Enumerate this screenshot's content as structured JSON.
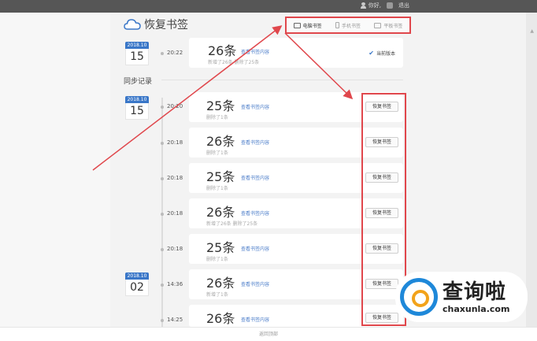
{
  "topbar": {
    "greeting": "你好,",
    "logout": "退出"
  },
  "page": {
    "title": "恢复书签"
  },
  "tabs": [
    {
      "label": "电脑书签",
      "active": true
    },
    {
      "label": "手机书签",
      "active": false
    },
    {
      "label": "平板书签",
      "active": false
    }
  ],
  "current": {
    "date_ym": "2018.10",
    "date_day": "15",
    "time": "20:22",
    "count": "26条",
    "view_label": "查看书签内容",
    "detail": "新增了26条  删除了25条",
    "status": "当前版本"
  },
  "section": {
    "title": "同步记录"
  },
  "groups": [
    {
      "date_ym": "2018.10",
      "date_day": "15"
    },
    {
      "date_ym": "2018.10",
      "date_day": "02"
    }
  ],
  "records": [
    {
      "time": "20:20",
      "count": "25条",
      "view_label": "查看书签内容",
      "detail": "删除了1条",
      "button": "恢复书签"
    },
    {
      "time": "20:18",
      "count": "26条",
      "view_label": "查看书签内容",
      "detail": "删除了1条",
      "button": "恢复书签"
    },
    {
      "time": "20:18",
      "count": "25条",
      "view_label": "查看书签内容",
      "detail": "删除了1条",
      "button": "恢复书签"
    },
    {
      "time": "20:18",
      "count": "26条",
      "view_label": "查看书签内容",
      "detail": "新增了26条  删除了25条",
      "button": "恢复书签"
    },
    {
      "time": "20:18",
      "count": "25条",
      "view_label": "查看书签内容",
      "detail": "删除了1条",
      "button": "恢复书签"
    },
    {
      "time": "14:36",
      "count": "26条",
      "view_label": "查看书签内容",
      "detail": "新增了1条",
      "button": "恢复书签"
    },
    {
      "time": "14:25",
      "count": "26条",
      "view_label": "查看书签内容",
      "detail": "",
      "button": "恢复书签"
    }
  ],
  "footer": {
    "label": "返回顶部"
  },
  "watermark": {
    "cn": "查询啦",
    "url": "chaxunla.com"
  },
  "colors": {
    "accent": "#3a77c8",
    "annotation": "#e0474c",
    "topbar": "#565656"
  }
}
